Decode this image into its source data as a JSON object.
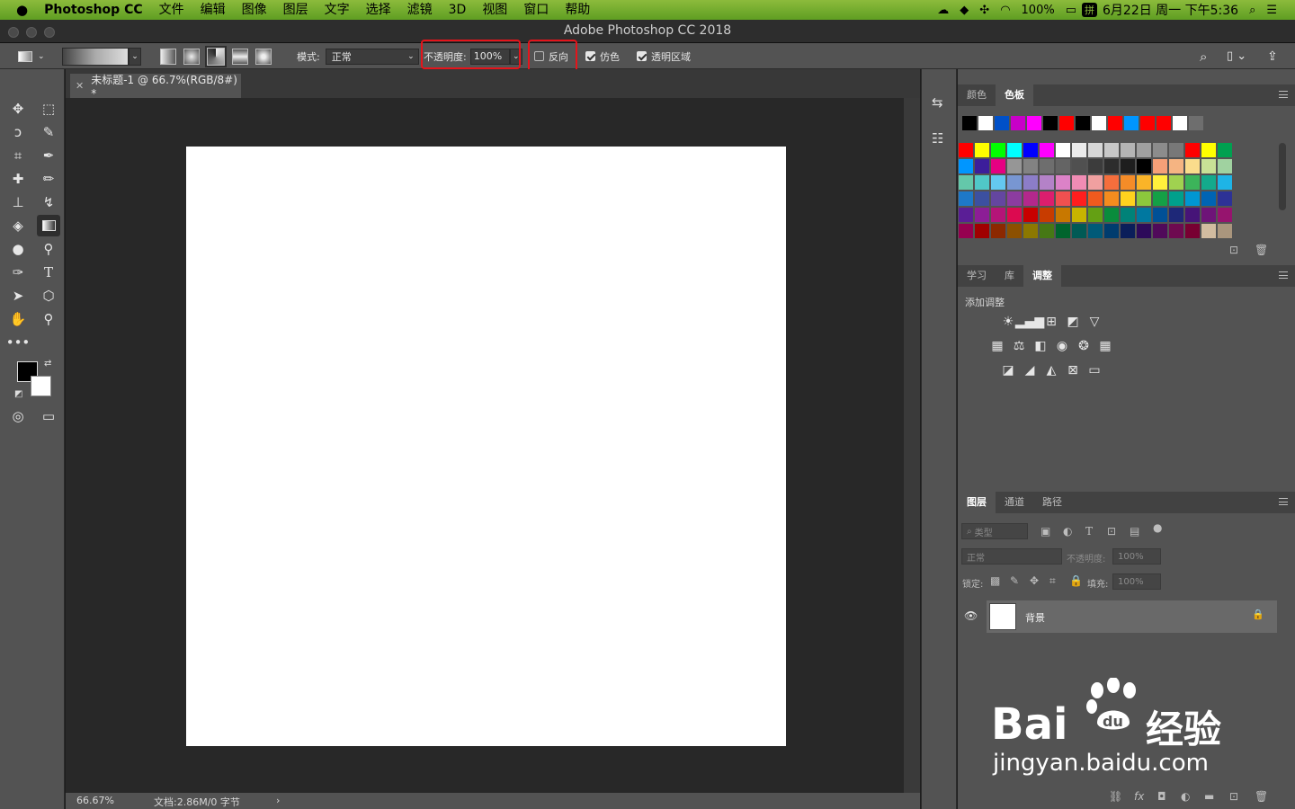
{
  "menubar": {
    "apple": "",
    "app_name": "Photoshop CC",
    "items": [
      "文件",
      "编辑",
      "图像",
      "图层",
      "文字",
      "选择",
      "滤镜",
      "3D",
      "视图",
      "窗口",
      "帮助"
    ],
    "battery": "100%",
    "input_method": "拼",
    "datetime": "6月22日 周一 下午5:36"
  },
  "title": "Adobe Photoshop CC 2018",
  "options": {
    "mode_label": "模式:",
    "mode_value": "正常",
    "opacity_label": "不透明度:",
    "opacity_value": "100%",
    "reverse_label": "反向",
    "reverse_checked": false,
    "dither_label": "仿色",
    "dither_checked": true,
    "transparency_label": "透明区域",
    "transparency_checked": true
  },
  "document": {
    "tab_title": "未标题-1 @ 66.7%(RGB/8#) *",
    "zoom": "66.67%",
    "doc_info": "文档:2.86M/0 字节"
  },
  "swatches_panel": {
    "tabs": [
      "颜色",
      "色板"
    ],
    "active_tab": "色板",
    "recent_colors": [
      "#000000",
      "#ffffff",
      "#0050c8",
      "#c800c8",
      "#ff00ff",
      "#000000",
      "#ff0000",
      "#000000",
      "#ffffff",
      "#ff0000",
      "#0096ff",
      "#ff0000",
      "#ff0000",
      "#ffffff",
      "#6e6e6e"
    ],
    "rows": [
      [
        "#ff0000",
        "#ffff00",
        "#00ff00",
        "#00ffff",
        "#0000ff",
        "#ff00ff",
        "#ffffff",
        "#ebebeb",
        "#d7d7d7",
        "#c8c8c8",
        "#b4b4b4",
        "#a0a0a0",
        "#8c8c8c",
        "#787878",
        "#ff0000",
        "#ffff00",
        "#00a050"
      ],
      [
        "#0096ff",
        "#3c1e9b",
        "#e60082",
        "#969696",
        "#828282",
        "#6e6e6e",
        "#646464",
        "#505050",
        "#3c3c3c",
        "#2d2d2d",
        "#1e1e1e",
        "#000000",
        "#f5a078",
        "#f5b482",
        "#fadc8c",
        "#c8e196",
        "#a0d2a0"
      ],
      [
        "#64c8aa",
        "#50c8c8",
        "#64c8f0",
        "#7896d2",
        "#8c7dc8",
        "#b482c8",
        "#dc82c8",
        "#f08cb4",
        "#f0a0a0",
        "#f56e3c",
        "#f58c28",
        "#fab428",
        "#fff03c",
        "#a0d250",
        "#3cb45a",
        "#14aa8c",
        "#1eb4e6"
      ],
      [
        "#1e78c8",
        "#3c50a0",
        "#6446a0",
        "#8c3ca0",
        "#b4288c",
        "#dc1e6e",
        "#f05050",
        "#ff1e1e",
        "#f05a1e",
        "#f58c1e",
        "#ffd21e",
        "#8cc83c",
        "#14a046",
        "#00a08c",
        "#0096d2",
        "#0064b4",
        "#2d3296"
      ],
      [
        "#5a1e96",
        "#8c1e96",
        "#b41478",
        "#dc0a50",
        "#c80000",
        "#c83c00",
        "#c87800",
        "#c8b400",
        "#64a014",
        "#0a8c3c",
        "#008278",
        "#0078a0",
        "#005096",
        "#1e2878",
        "#461478",
        "#6e1478",
        "#96146e"
      ],
      [
        "#960050",
        "#a00000",
        "#8c2800",
        "#8c5000",
        "#8c7800",
        "#467814",
        "#00642d",
        "#005a55",
        "#005a78",
        "#003c6e",
        "#0a1e5a",
        "#2d0a5a",
        "#500a5a",
        "#6e0a50",
        "#780032",
        "#d2bca0",
        "#aa967d"
      ]
    ]
  },
  "adjustments_panel": {
    "tabs": [
      "学习",
      "库",
      "调整"
    ],
    "active_tab": "调整",
    "heading": "添加调整",
    "icons_row1": [
      "brightness-icon",
      "levels-icon",
      "curves-icon",
      "exposure-icon",
      "vibrance-icon"
    ],
    "icons_row2": [
      "hue-saturation-icon",
      "color-balance-icon",
      "black-white-icon",
      "photo-filter-icon",
      "channel-mixer-icon",
      "color-lookup-icon"
    ],
    "icons_row3": [
      "invert-icon",
      "posterize-icon",
      "threshold-icon",
      "selective-color-icon",
      "gradient-map-icon"
    ]
  },
  "layers_panel": {
    "tabs": [
      "图层",
      "通道",
      "路径"
    ],
    "active_tab": "图层",
    "filter_label": "类型",
    "blend_mode": "正常",
    "opacity_label": "不透明度:",
    "opacity_value": "100%",
    "lock_label": "锁定:",
    "fill_label": "填充:",
    "fill_value": "100%",
    "layers": [
      {
        "name": "背景",
        "visible": true,
        "locked": true
      }
    ]
  },
  "watermark": {
    "brand": "Bai",
    "brand_cn": "经验",
    "url": "jingyan.baidu.com"
  },
  "colors": {
    "annotation": "#e5141b",
    "foreground": "#000000",
    "background": "#ffffff"
  }
}
